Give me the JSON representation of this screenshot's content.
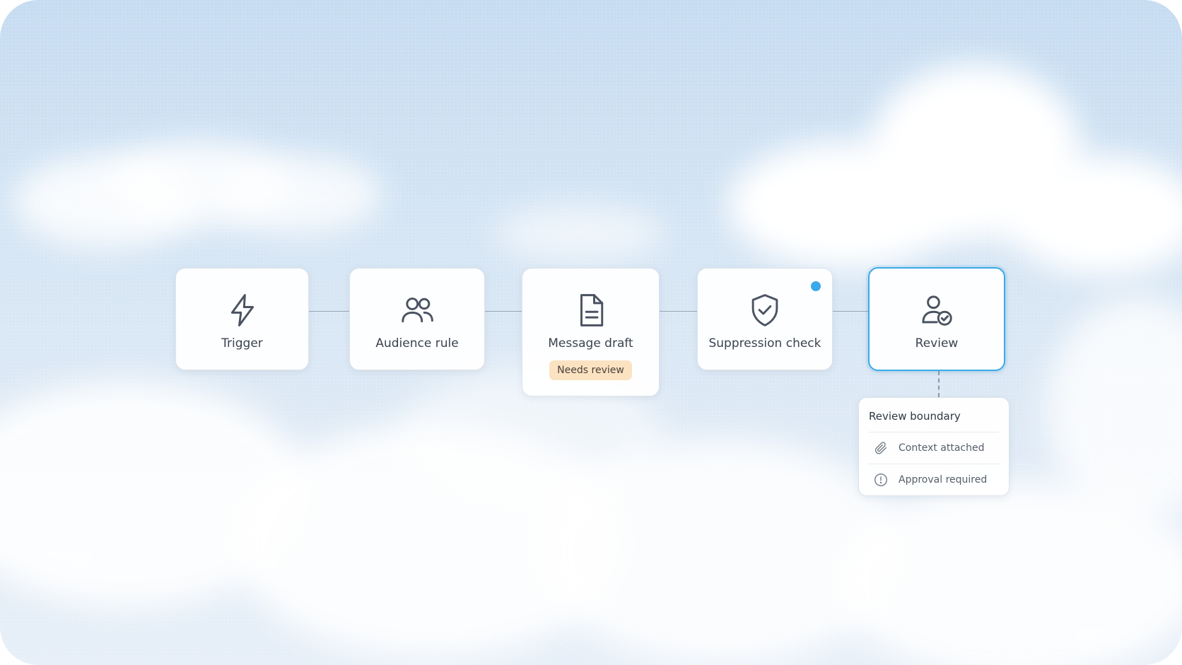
{
  "flow": {
    "nodes": [
      {
        "id": "trigger",
        "label": "Trigger",
        "icon": "lightning-bolt-icon"
      },
      {
        "id": "audience",
        "label": "Audience rule",
        "icon": "users-icon"
      },
      {
        "id": "message",
        "label": "Message draft",
        "icon": "document-icon",
        "badge": "Needs review"
      },
      {
        "id": "suppression",
        "label": "Suppression check",
        "icon": "shield-check-icon",
        "status_dot": true
      },
      {
        "id": "review",
        "label": "Review",
        "icon": "user-check-icon",
        "selected": true
      }
    ]
  },
  "review_panel": {
    "title": "Review boundary",
    "rows": [
      {
        "label": "Context attached",
        "icon": "paperclip-icon"
      },
      {
        "label": "Approval required",
        "icon": "alert-circle-icon"
      }
    ]
  },
  "colors": {
    "accent": "#3aa8e6",
    "badge_bg": "#fbe3c2",
    "status_dot": "#3aa8ea"
  }
}
